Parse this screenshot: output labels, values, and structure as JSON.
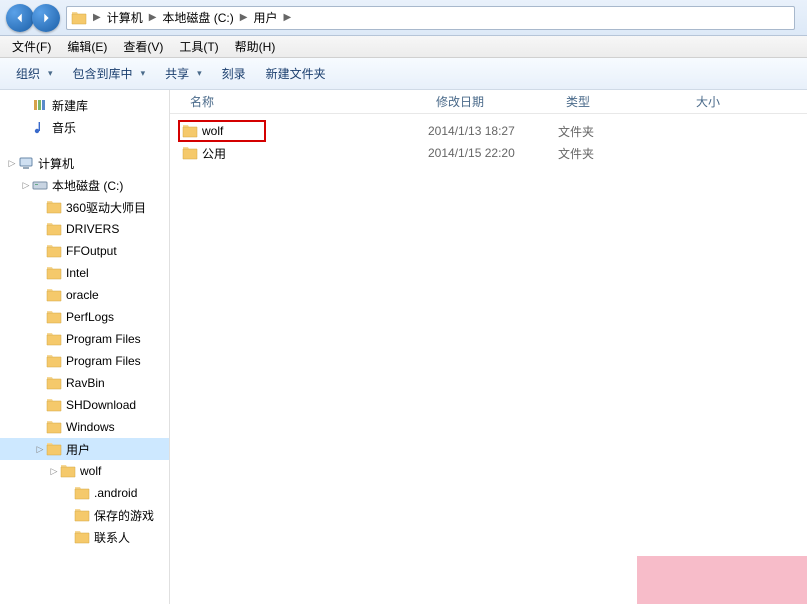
{
  "breadcrumb": {
    "root_icon": "computer",
    "items": [
      "计算机",
      "本地磁盘 (C:)",
      "用户"
    ]
  },
  "menubar": [
    {
      "label": "文件(F)"
    },
    {
      "label": "编辑(E)"
    },
    {
      "label": "查看(V)"
    },
    {
      "label": "工具(T)"
    },
    {
      "label": "帮助(H)"
    }
  ],
  "toolbar": {
    "organize": "组织",
    "library": "包含到库中",
    "share": "共享",
    "burn": "刻录",
    "newfolder": "新建文件夹"
  },
  "columns": {
    "name": "名称",
    "date": "修改日期",
    "type": "类型",
    "size": "大小"
  },
  "rows": [
    {
      "name": "wolf",
      "date": "2014/1/13 18:27",
      "type": "文件夹",
      "highlight": true
    },
    {
      "name": "公用",
      "date": "2014/1/15 22:20",
      "type": "文件夹"
    }
  ],
  "sidebar": [
    {
      "label": "新建库",
      "indent": 1,
      "icon": "lib"
    },
    {
      "label": "音乐",
      "indent": 1,
      "icon": "music"
    },
    {
      "spacer": true
    },
    {
      "label": "计算机",
      "indent": 0,
      "icon": "computer",
      "exp": "▷"
    },
    {
      "label": "本地磁盘 (C:)",
      "indent": 1,
      "icon": "drive",
      "exp": "▷"
    },
    {
      "label": "360驱动大师目",
      "indent": 2,
      "icon": "folder"
    },
    {
      "label": "DRIVERS",
      "indent": 2,
      "icon": "folder"
    },
    {
      "label": "FFOutput",
      "indent": 2,
      "icon": "folder"
    },
    {
      "label": "Intel",
      "indent": 2,
      "icon": "folder"
    },
    {
      "label": "oracle",
      "indent": 2,
      "icon": "folder"
    },
    {
      "label": "PerfLogs",
      "indent": 2,
      "icon": "folder"
    },
    {
      "label": "Program Files",
      "indent": 2,
      "icon": "folder"
    },
    {
      "label": "Program Files",
      "indent": 2,
      "icon": "folder"
    },
    {
      "label": "RavBin",
      "indent": 2,
      "icon": "folder"
    },
    {
      "label": "SHDownload",
      "indent": 2,
      "icon": "folder"
    },
    {
      "label": "Windows",
      "indent": 2,
      "icon": "folder"
    },
    {
      "label": "用户",
      "indent": 2,
      "icon": "folder",
      "sel": true,
      "exp": "▷"
    },
    {
      "label": "wolf",
      "indent": 3,
      "icon": "folder-lock",
      "exp": "▷"
    },
    {
      "label": ".android",
      "indent": 4,
      "icon": "folder"
    },
    {
      "label": "保存的游戏",
      "indent": 4,
      "icon": "folder-game"
    },
    {
      "label": "联系人",
      "indent": 4,
      "icon": "folder-contact"
    }
  ]
}
